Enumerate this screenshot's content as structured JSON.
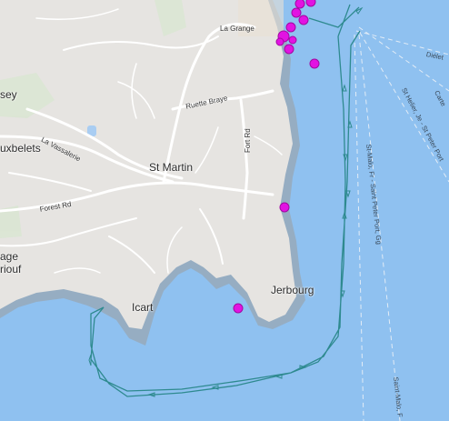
{
  "map": {
    "colors": {
      "sea": "#8fc1f0",
      "land": "#e6e4e1",
      "road": "#ffffff",
      "track": "#2e8a8f",
      "marker": "#e213e2",
      "marker_stroke": "#a10aa1",
      "shipping_lane": "#dfe9f3"
    },
    "places": {
      "la_grange": "La Grange",
      "sey": "sey",
      "uxbelets": "uxbelets",
      "st_martin": "St Martin",
      "age": "age",
      "riouf": "riouf",
      "icart": "Icart",
      "jerbourg": "Jerbourg"
    },
    "roads": {
      "ruette_braye": "Ruette Braye",
      "fort_rd": "Fort Rd",
      "la_vassalerie": "La Vassalerie",
      "forest_rd": "Forest Rd"
    },
    "ferry_routes": {
      "dielet": "Diélet",
      "carte": "Carte",
      "st_helier_je": "St Helier, Je - St Peter Port",
      "st_malo_fr": "St-Malo, Fr - Saint Peter Port, Gg",
      "st_malo_f": "Saint-Malo, F"
    }
  }
}
